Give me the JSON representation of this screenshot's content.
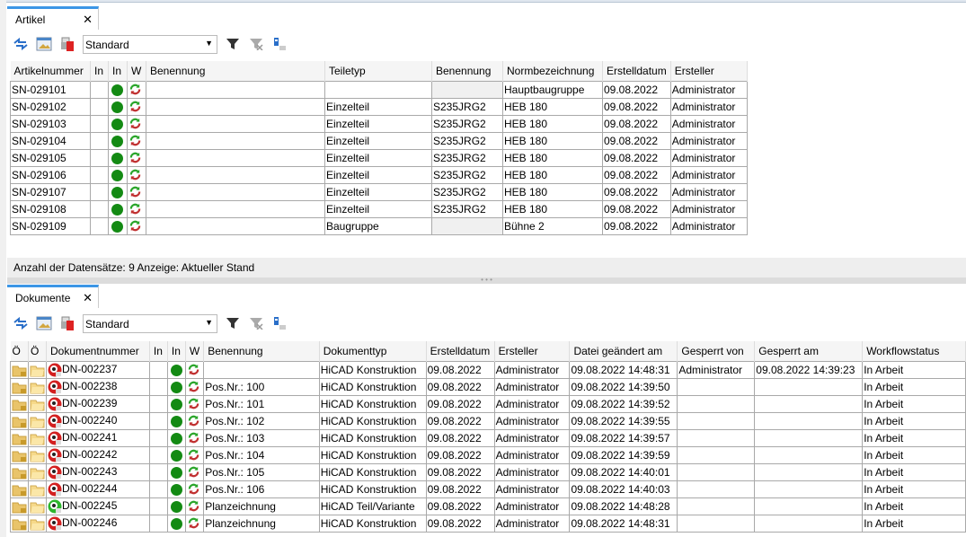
{
  "artikel": {
    "tab_label": "Artikel",
    "view_select": "Standard",
    "columns": [
      "Artikelnummer",
      "In",
      "In",
      "W",
      "Benennung",
      "Teiletyp",
      "Benennung",
      "Normbezeichnung",
      "Erstelldatum",
      "Ersteller"
    ],
    "rows": [
      [
        "SN-029101",
        "",
        "",
        "Hauptbaugruppe",
        "09.08.2022",
        "Administrator"
      ],
      [
        "SN-029102",
        "Einzelteil",
        "S235JRG2",
        "HEB 180",
        "09.08.2022",
        "Administrator"
      ],
      [
        "SN-029103",
        "Einzelteil",
        "S235JRG2",
        "HEB 180",
        "09.08.2022",
        "Administrator"
      ],
      [
        "SN-029104",
        "Einzelteil",
        "S235JRG2",
        "HEB 180",
        "09.08.2022",
        "Administrator"
      ],
      [
        "SN-029105",
        "Einzelteil",
        "S235JRG2",
        "HEB 180",
        "09.08.2022",
        "Administrator"
      ],
      [
        "SN-029106",
        "Einzelteil",
        "S235JRG2",
        "HEB 180",
        "09.08.2022",
        "Administrator"
      ],
      [
        "SN-029107",
        "Einzelteil",
        "S235JRG2",
        "HEB 180",
        "09.08.2022",
        "Administrator"
      ],
      [
        "SN-029108",
        "Einzelteil",
        "S235JRG2",
        "HEB 180",
        "09.08.2022",
        "Administrator"
      ],
      [
        "SN-029109",
        "Baugruppe",
        "",
        "Bühne 2",
        "09.08.2022",
        "Administrator"
      ]
    ],
    "status": "Anzahl der Datensätze: 9   Anzeige: Aktueller Stand"
  },
  "dokumente": {
    "tab_label": "Dokumente",
    "view_select": "Standard",
    "columns": [
      "Ö",
      "Ö",
      "Dokumentnummer",
      "In",
      "In",
      "W",
      "Benennung",
      "Dokumenttyp",
      "Erstelldatum",
      "Ersteller",
      "Datei geändert am",
      "Gesperrt von",
      "Gesperrt am",
      "Workflowstatus"
    ],
    "rows": [
      [
        "DN-002237",
        "",
        "HiCAD Konstruktion",
        "09.08.2022",
        "Administrator",
        "09.08.2022 14:48:31",
        "Administrator",
        "09.08.2022 14:39:23",
        "In Arbeit"
      ],
      [
        "DN-002238",
        "Pos.Nr.: 100",
        "HiCAD Konstruktion",
        "09.08.2022",
        "Administrator",
        "09.08.2022 14:39:50",
        "",
        "",
        "In Arbeit"
      ],
      [
        "DN-002239",
        "Pos.Nr.: 101",
        "HiCAD Konstruktion",
        "09.08.2022",
        "Administrator",
        "09.08.2022 14:39:52",
        "",
        "",
        "In Arbeit"
      ],
      [
        "DN-002240",
        "Pos.Nr.: 102",
        "HiCAD Konstruktion",
        "09.08.2022",
        "Administrator",
        "09.08.2022 14:39:55",
        "",
        "",
        "In Arbeit"
      ],
      [
        "DN-002241",
        "Pos.Nr.: 103",
        "HiCAD Konstruktion",
        "09.08.2022",
        "Administrator",
        "09.08.2022 14:39:57",
        "",
        "",
        "In Arbeit"
      ],
      [
        "DN-002242",
        "Pos.Nr.: 104",
        "HiCAD Konstruktion",
        "09.08.2022",
        "Administrator",
        "09.08.2022 14:39:59",
        "",
        "",
        "In Arbeit"
      ],
      [
        "DN-002243",
        "Pos.Nr.: 105",
        "HiCAD Konstruktion",
        "09.08.2022",
        "Administrator",
        "09.08.2022 14:40:01",
        "",
        "",
        "In Arbeit"
      ],
      [
        "DN-002244",
        "Pos.Nr.: 106",
        "HiCAD Konstruktion",
        "09.08.2022",
        "Administrator",
        "09.08.2022 14:40:03",
        "",
        "",
        "In Arbeit"
      ],
      [
        "DN-002245",
        "Planzeichnung",
        "HiCAD Teil/Variante",
        "09.08.2022",
        "Administrator",
        "09.08.2022 14:48:28",
        "",
        "",
        "In Arbeit"
      ],
      [
        "DN-002246",
        "Planzeichnung",
        "HiCAD Konstruktion",
        "09.08.2022",
        "Administrator",
        "09.08.2022 14:48:31",
        "",
        "",
        "In Arbeit"
      ]
    ],
    "doc_icon_colors": [
      "#d32020",
      "#d32020",
      "#d32020",
      "#d32020",
      "#d32020",
      "#d32020",
      "#d32020",
      "#d32020",
      "#2db52d",
      "#d32020"
    ]
  },
  "icons": {
    "refresh": "refresh-icon",
    "image": "image-icon",
    "print": "print-icon",
    "filter": "filter-icon",
    "clear_filter": "clear-filter-icon",
    "columns": "columns-icon",
    "status_ok": "#138a13"
  }
}
